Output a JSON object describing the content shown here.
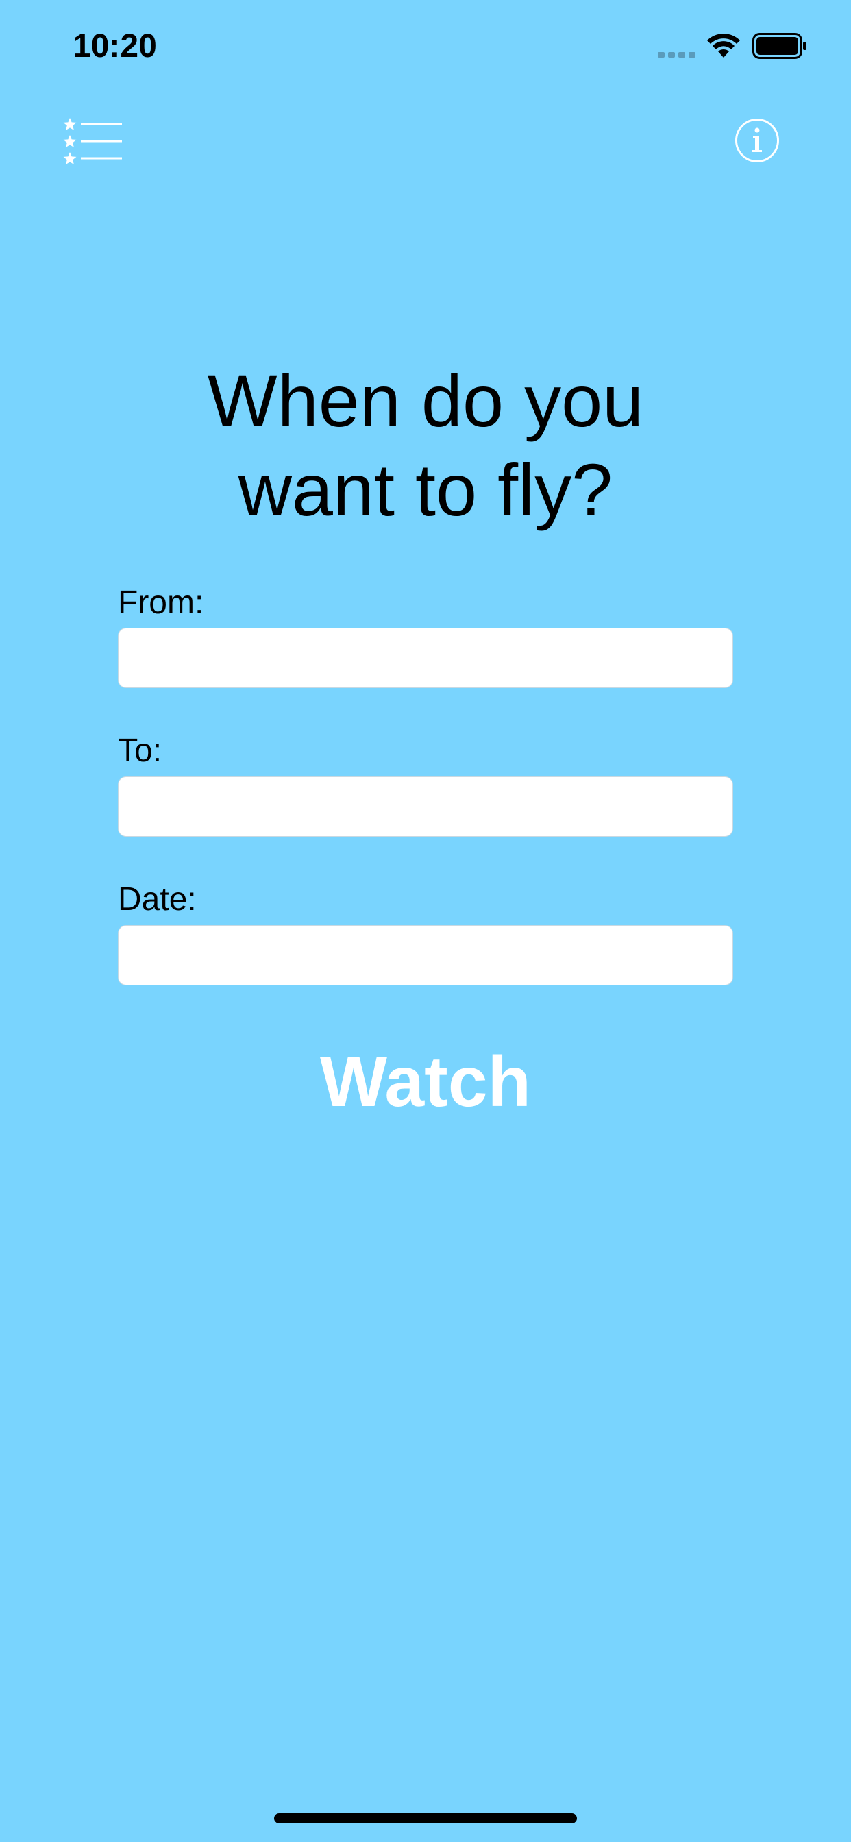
{
  "status_bar": {
    "time": "10:20"
  },
  "nav": {
    "favorites_icon": "star-list-icon",
    "info_icon": "info-icon"
  },
  "main": {
    "title": "When do you\nwant to fly?",
    "fields": [
      {
        "label": "From:",
        "value": "",
        "placeholder": ""
      },
      {
        "label": "To:",
        "value": "",
        "placeholder": ""
      },
      {
        "label": "Date:",
        "value": "",
        "placeholder": ""
      }
    ],
    "watch_label": "Watch"
  },
  "colors": {
    "background": "#79d4fe",
    "button_text": "#ffffff",
    "input_background": "#ffffff"
  }
}
